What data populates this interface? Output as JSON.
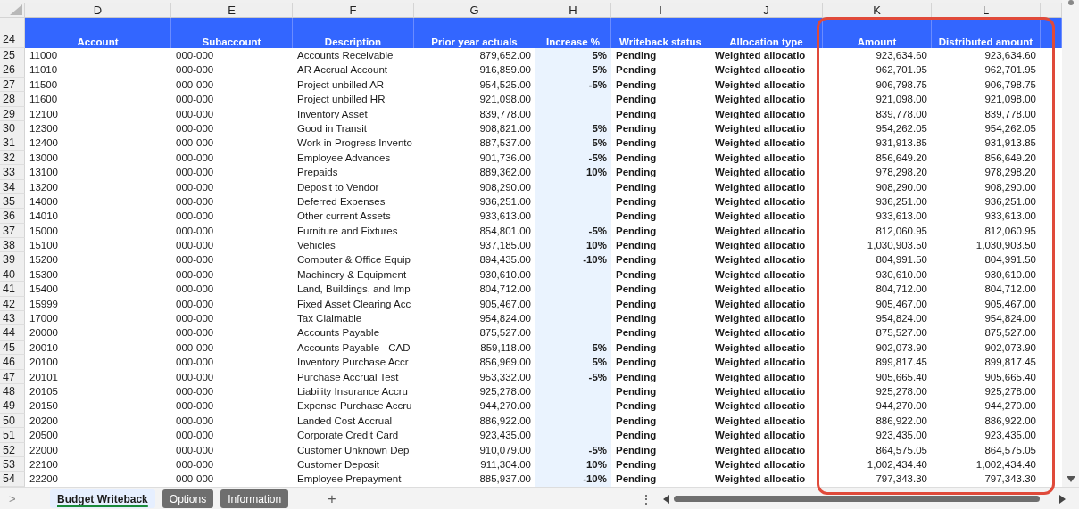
{
  "annotation": {
    "kind": "outline"
  },
  "column_letters": [
    "D",
    "E",
    "F",
    "G",
    "H",
    "I",
    "J",
    "K",
    "L"
  ],
  "header_row": "24",
  "headers": [
    "Account",
    "Subaccount",
    "Description",
    "Prior year actuals",
    "Increase %",
    "Writeback status",
    "Allocation type",
    "Amount",
    "Distributed amount"
  ],
  "rows": [
    {
      "n": "25",
      "account": "11000",
      "subaccount": "000-000",
      "description": "Accounts Receivable",
      "prior": "879,652.00",
      "increase": "5%",
      "status": "Pending",
      "allocation": "Weighted allocatio",
      "amount": "923,634.60",
      "distributed": "923,634.60"
    },
    {
      "n": "26",
      "account": "11010",
      "subaccount": "000-000",
      "description": "AR Accrual Account",
      "prior": "916,859.00",
      "increase": "5%",
      "status": "Pending",
      "allocation": "Weighted allocatio",
      "amount": "962,701.95",
      "distributed": "962,701.95"
    },
    {
      "n": "27",
      "account": "11500",
      "subaccount": "000-000",
      "description": "Project unbilled AR",
      "prior": "954,525.00",
      "increase": "-5%",
      "status": "Pending",
      "allocation": "Weighted allocatio",
      "amount": "906,798.75",
      "distributed": "906,798.75"
    },
    {
      "n": "28",
      "account": "11600",
      "subaccount": "000-000",
      "description": "Project unbilled HR",
      "prior": "921,098.00",
      "status": "Pending",
      "allocation": "Weighted allocatio",
      "amount": "921,098.00",
      "distributed": "921,098.00"
    },
    {
      "n": "29",
      "account": "12100",
      "subaccount": "000-000",
      "description": "Inventory Asset",
      "prior": "839,778.00",
      "status": "Pending",
      "allocation": "Weighted allocatio",
      "amount": "839,778.00",
      "distributed": "839,778.00"
    },
    {
      "n": "30",
      "account": "12300",
      "subaccount": "000-000",
      "description": "Good in Transit",
      "prior": "908,821.00",
      "increase": "5%",
      "status": "Pending",
      "allocation": "Weighted allocatio",
      "amount": "954,262.05",
      "distributed": "954,262.05"
    },
    {
      "n": "31",
      "account": "12400",
      "subaccount": "000-000",
      "description": "Work in Progress Invento",
      "prior": "887,537.00",
      "increase": "5%",
      "status": "Pending",
      "allocation": "Weighted allocatio",
      "amount": "931,913.85",
      "distributed": "931,913.85"
    },
    {
      "n": "32",
      "account": "13000",
      "subaccount": "000-000",
      "description": "Employee Advances",
      "prior": "901,736.00",
      "increase": "-5%",
      "status": "Pending",
      "allocation": "Weighted allocatio",
      "amount": "856,649.20",
      "distributed": "856,649.20"
    },
    {
      "n": "33",
      "account": "13100",
      "subaccount": "000-000",
      "description": "Prepaids",
      "prior": "889,362.00",
      "increase": "10%",
      "status": "Pending",
      "allocation": "Weighted allocatio",
      "amount": "978,298.20",
      "distributed": "978,298.20"
    },
    {
      "n": "34",
      "account": "13200",
      "subaccount": "000-000",
      "description": "Deposit to Vendor",
      "prior": "908,290.00",
      "status": "Pending",
      "allocation": "Weighted allocatio",
      "amount": "908,290.00",
      "distributed": "908,290.00"
    },
    {
      "n": "35",
      "account": "14000",
      "subaccount": "000-000",
      "description": "Deferred Expenses",
      "prior": "936,251.00",
      "status": "Pending",
      "allocation": "Weighted allocatio",
      "amount": "936,251.00",
      "distributed": "936,251.00"
    },
    {
      "n": "36",
      "account": "14010",
      "subaccount": "000-000",
      "description": "Other current Assets",
      "prior": "933,613.00",
      "status": "Pending",
      "allocation": "Weighted allocatio",
      "amount": "933,613.00",
      "distributed": "933,613.00"
    },
    {
      "n": "37",
      "account": "15000",
      "subaccount": "000-000",
      "description": "Furniture and Fixtures",
      "prior": "854,801.00",
      "increase": "-5%",
      "status": "Pending",
      "allocation": "Weighted allocatio",
      "amount": "812,060.95",
      "distributed": "812,060.95"
    },
    {
      "n": "38",
      "account": "15100",
      "subaccount": "000-000",
      "description": "Vehicles",
      "prior": "937,185.00",
      "increase": "10%",
      "status": "Pending",
      "allocation": "Weighted allocatio",
      "amount": "1,030,903.50",
      "distributed": "1,030,903.50"
    },
    {
      "n": "39",
      "account": "15200",
      "subaccount": "000-000",
      "description": "Computer & Office Equip",
      "prior": "894,435.00",
      "increase": "-10%",
      "status": "Pending",
      "allocation": "Weighted allocatio",
      "amount": "804,991.50",
      "distributed": "804,991.50"
    },
    {
      "n": "40",
      "account": "15300",
      "subaccount": "000-000",
      "description": "Machinery & Equipment",
      "prior": "930,610.00",
      "status": "Pending",
      "allocation": "Weighted allocatio",
      "amount": "930,610.00",
      "distributed": "930,610.00"
    },
    {
      "n": "41",
      "account": "15400",
      "subaccount": "000-000",
      "description": "Land, Buildings, and Imp",
      "prior": "804,712.00",
      "status": "Pending",
      "allocation": "Weighted allocatio",
      "amount": "804,712.00",
      "distributed": "804,712.00"
    },
    {
      "n": "42",
      "account": "15999",
      "subaccount": "000-000",
      "description": "Fixed Asset Clearing Acc",
      "prior": "905,467.00",
      "status": "Pending",
      "allocation": "Weighted allocatio",
      "amount": "905,467.00",
      "distributed": "905,467.00"
    },
    {
      "n": "43",
      "account": "17000",
      "subaccount": "000-000",
      "description": "Tax Claimable",
      "prior": "954,824.00",
      "status": "Pending",
      "allocation": "Weighted allocatio",
      "amount": "954,824.00",
      "distributed": "954,824.00"
    },
    {
      "n": "44",
      "account": "20000",
      "subaccount": "000-000",
      "description": "Accounts Payable",
      "prior": "875,527.00",
      "status": "Pending",
      "allocation": "Weighted allocatio",
      "amount": "875,527.00",
      "distributed": "875,527.00"
    },
    {
      "n": "45",
      "account": "20010",
      "subaccount": "000-000",
      "description": "Accounts Payable - CAD",
      "prior": "859,118.00",
      "increase": "5%",
      "status": "Pending",
      "allocation": "Weighted allocatio",
      "amount": "902,073.90",
      "distributed": "902,073.90"
    },
    {
      "n": "46",
      "account": "20100",
      "subaccount": "000-000",
      "description": "Inventory Purchase Accr",
      "prior": "856,969.00",
      "increase": "5%",
      "status": "Pending",
      "allocation": "Weighted allocatio",
      "amount": "899,817.45",
      "distributed": "899,817.45"
    },
    {
      "n": "47",
      "account": "20101",
      "subaccount": "000-000",
      "description": "Purchase Accrual Test",
      "prior": "953,332.00",
      "increase": "-5%",
      "status": "Pending",
      "allocation": "Weighted allocatio",
      "amount": "905,665.40",
      "distributed": "905,665.40"
    },
    {
      "n": "48",
      "account": "20105",
      "subaccount": "000-000",
      "description": "Liability Insurance Accru",
      "prior": "925,278.00",
      "status": "Pending",
      "allocation": "Weighted allocatio",
      "amount": "925,278.00",
      "distributed": "925,278.00"
    },
    {
      "n": "49",
      "account": "20150",
      "subaccount": "000-000",
      "description": "Expense Purchase Accru",
      "prior": "944,270.00",
      "status": "Pending",
      "allocation": "Weighted allocatio",
      "amount": "944,270.00",
      "distributed": "944,270.00"
    },
    {
      "n": "50",
      "account": "20200",
      "subaccount": "000-000",
      "description": "Landed Cost Accrual",
      "prior": "886,922.00",
      "status": "Pending",
      "allocation": "Weighted allocatio",
      "amount": "886,922.00",
      "distributed": "886,922.00"
    },
    {
      "n": "51",
      "account": "20500",
      "subaccount": "000-000",
      "description": "Corporate Credit Card",
      "prior": "923,435.00",
      "status": "Pending",
      "allocation": "Weighted allocatio",
      "amount": "923,435.00",
      "distributed": "923,435.00"
    },
    {
      "n": "52",
      "account": "22000",
      "subaccount": "000-000",
      "description": "Customer Unknown Dep",
      "prior": "910,079.00",
      "increase": "-5%",
      "status": "Pending",
      "allocation": "Weighted allocatio",
      "amount": "864,575.05",
      "distributed": "864,575.05"
    },
    {
      "n": "53",
      "account": "22100",
      "subaccount": "000-000",
      "description": "Customer Deposit",
      "prior": "911,304.00",
      "increase": "10%",
      "status": "Pending",
      "allocation": "Weighted allocatio",
      "amount": "1,002,434.40",
      "distributed": "1,002,434.40"
    },
    {
      "n": "54",
      "account": "22200",
      "subaccount": "000-000",
      "description": "Employee Prepayment",
      "prior": "885,937.00",
      "increase": "-10%",
      "status": "Pending",
      "allocation": "Weighted allocatio",
      "amount": "797,343.30",
      "distributed": "797,343.30"
    }
  ],
  "sheet_tabs": [
    {
      "label": "Budget Writeback",
      "selected": true
    },
    {
      "label": "Options",
      "selected": false
    },
    {
      "label": "Information",
      "selected": false
    }
  ],
  "nav_arrow": ">",
  "add_sheet": "+",
  "more_menu": "⋮"
}
